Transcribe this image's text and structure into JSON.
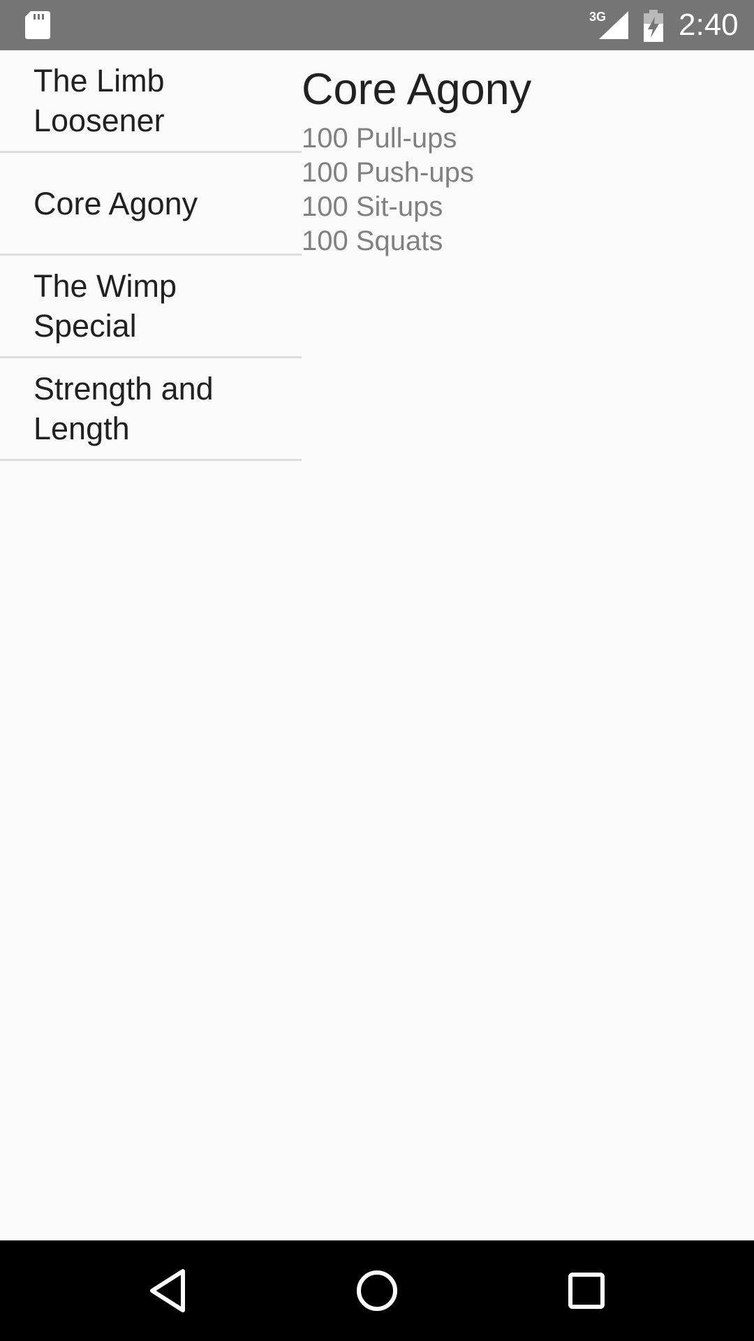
{
  "status_bar": {
    "network": "3G",
    "time": "2:40"
  },
  "workouts": [
    {
      "label": "The Limb Loosener"
    },
    {
      "label": "Core Agony"
    },
    {
      "label": "The Wimp Special"
    },
    {
      "label": "Strength and Length"
    }
  ],
  "detail": {
    "title": "Core Agony",
    "exercises": [
      "100 Pull-ups",
      "100 Push-ups",
      "100 Sit-ups",
      "100 Squats"
    ]
  },
  "icons": {
    "sd_card": "sd-card-icon",
    "signal": "signal-icon",
    "battery": "battery-charging-icon",
    "back": "back-icon",
    "home": "home-icon",
    "recents": "recents-icon"
  }
}
